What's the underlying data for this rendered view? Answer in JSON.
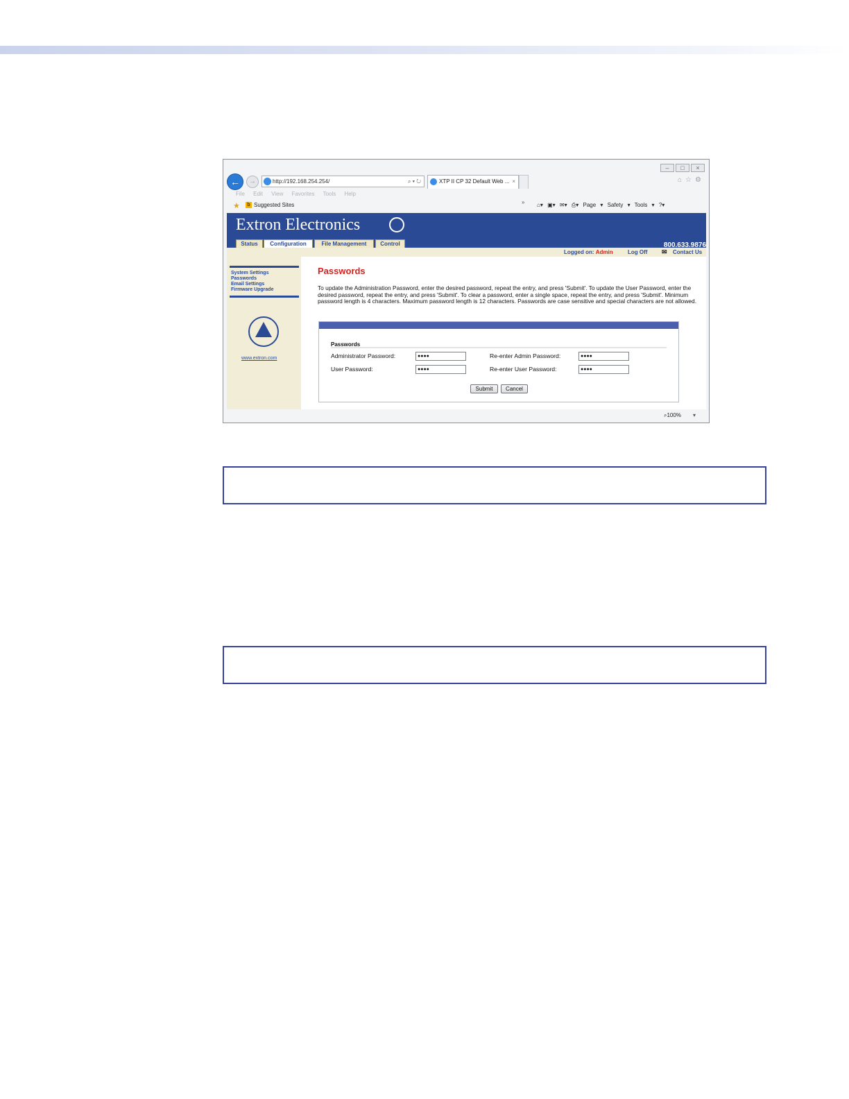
{
  "browser": {
    "url": "http://192.168.254.254/",
    "tab_title": "XTP II CP 32 Default Web ...",
    "tab_close": "×",
    "menu": [
      "File",
      "Edit",
      "View",
      "Favorites",
      "Tools",
      "Help"
    ],
    "favorites_label": "Suggested Sites",
    "command_bar": "Page ▾   Safety ▾   Tools ▾",
    "zoom": "100%"
  },
  "site": {
    "brand": "Extron Electronics",
    "tabs": [
      "Status",
      "Configuration",
      "File Management",
      "Control"
    ],
    "phone": "800.633.9876",
    "logged_on_label": "Logged on:",
    "logged_on_user": "Admin",
    "log_off": "Log Off",
    "contact": "Contact Us"
  },
  "sidebar": {
    "items": [
      "System Settings",
      "Passwords",
      "Email Settings",
      "Firmware Upgrade"
    ],
    "url": "www.extron.com"
  },
  "page": {
    "title": "Passwords",
    "description": "To update the Administration Password, enter the desired password, repeat the entry, and press 'Submit'.  To update the User Password, enter the desired password, repeat the entry, and press 'Submit'.  To clear a password, enter a single space, repeat the entry, and press 'Submit'.  Minimum password length is 4 characters.  Maximum password length is 12 characters. Passwords are case sensitive and special characters are not allowed."
  },
  "form": {
    "legend": "Passwords",
    "admin_label": "Administrator Password:",
    "admin_value": "●●●●",
    "readmin_label": "Re-enter Admin Password:",
    "readmin_value": "●●●●",
    "user_label": "User Password:",
    "user_value": "●●●●",
    "reuser_label": "Re-enter User Password:",
    "reuser_value": "●●●●",
    "submit": "Submit",
    "cancel": "Cancel"
  },
  "colors": {
    "banner": "#2b4a96",
    "title_red": "#d4221f",
    "sidebar_bg": "#f1edd6",
    "note_border": "#34419e"
  }
}
